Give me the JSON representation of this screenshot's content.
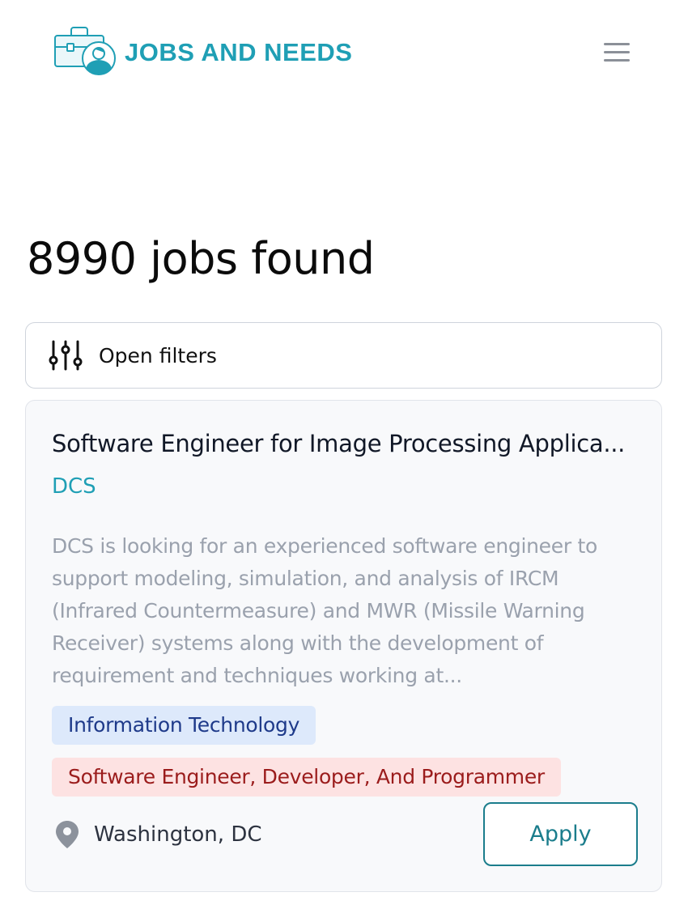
{
  "header": {
    "logo_text": "JOBS AND NEEDS",
    "logo_icon": "briefcase-person-icon",
    "menu_icon": "hamburger-menu-icon"
  },
  "results": {
    "title": "8990 jobs found"
  },
  "filters": {
    "label": "Open filters",
    "icon": "sliders-icon"
  },
  "jobs": [
    {
      "title": "Software Engineer for Image Processing Applica...",
      "company": "DCS",
      "description": "DCS is looking for an experienced software engineer to support modeling, simulation, and analysis of IRCM (Infrared Countermeasure) and MWR (Missile Warning Receiver) systems along with the development of requirement and techniques working at...",
      "tags": [
        "Information Technology",
        "Software Engineer, Developer, And Programmer"
      ],
      "location": "Washington, DC",
      "location_icon": "map-pin-icon",
      "apply_label": "Apply"
    }
  ],
  "colors": {
    "brand": "#1f9fb5",
    "apply": "#1b7d8c",
    "tag_blue_bg": "#dde9fb",
    "tag_blue_text": "#1e3a8a",
    "tag_red_bg": "#fde2e2",
    "tag_red_text": "#9b1c1c"
  }
}
